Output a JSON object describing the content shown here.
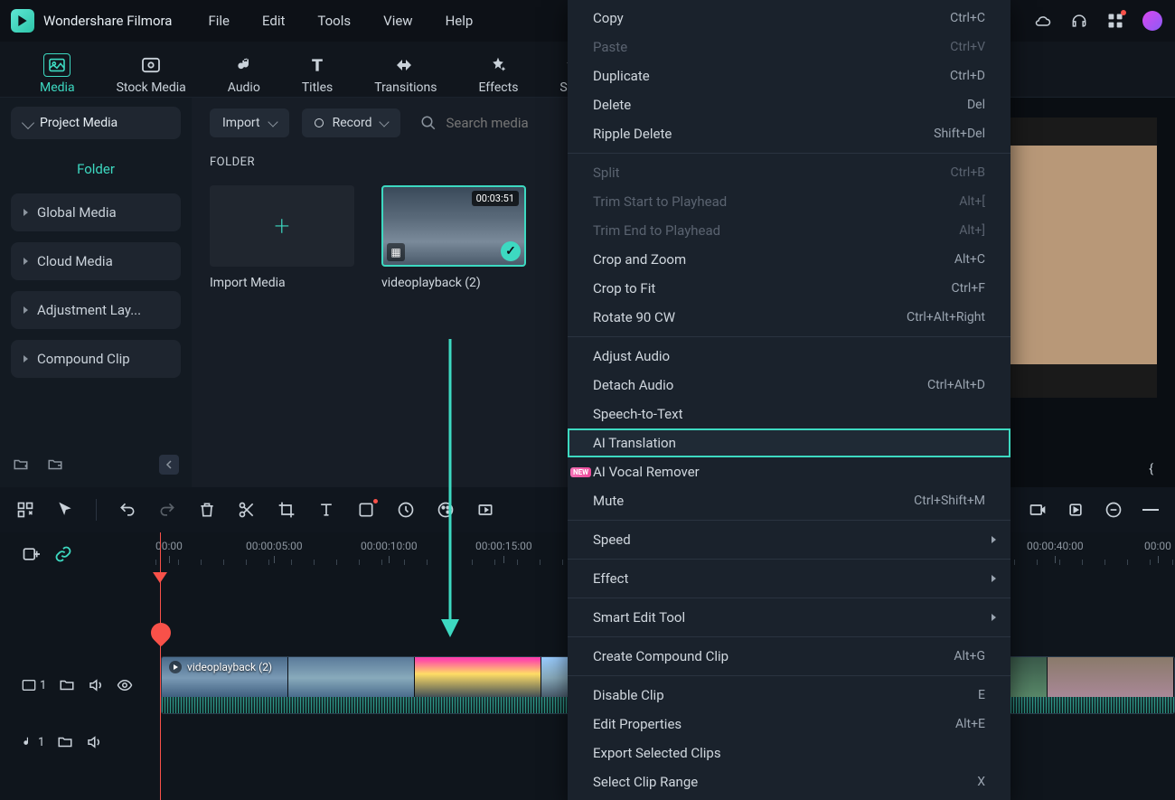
{
  "app_name": "Wondershare Filmora",
  "menu": [
    "File",
    "Edit",
    "Tools",
    "View",
    "Help"
  ],
  "tabs": [
    {
      "label": "Media",
      "active": true
    },
    {
      "label": "Stock Media"
    },
    {
      "label": "Audio"
    },
    {
      "label": "Titles"
    },
    {
      "label": "Transitions"
    },
    {
      "label": "Effects"
    },
    {
      "label": "Stick"
    }
  ],
  "sidebar": {
    "project_media": "Project Media",
    "folder": "Folder",
    "items": [
      "Global Media",
      "Cloud Media",
      "Adjustment Lay...",
      "Compound Clip"
    ]
  },
  "browser": {
    "import": "Import",
    "record": "Record",
    "search_placeholder": "Search media",
    "folder_header": "FOLDER",
    "import_media": "Import Media",
    "clip_name": "videoplayback (2)",
    "clip_duration": "00:03:51"
  },
  "ruler": [
    "00:00",
    "00:00:05:00",
    "00:00:10:00",
    "00:00:15:00",
    "00:00:40:00",
    "00:00"
  ],
  "timeline": {
    "video_track": "1",
    "audio_track": "1",
    "clip_label": "videoplayback (2)"
  },
  "preview": {
    "brace": "{"
  },
  "context": [
    {
      "label": "Copy",
      "short": "Ctrl+C"
    },
    {
      "label": "Paste",
      "short": "Ctrl+V",
      "disabled": true
    },
    {
      "label": "Duplicate",
      "short": "Ctrl+D"
    },
    {
      "label": "Delete",
      "short": "Del"
    },
    {
      "label": "Ripple Delete",
      "short": "Shift+Del"
    },
    {
      "separator": true
    },
    {
      "label": "Split",
      "short": "Ctrl+B",
      "disabled": true
    },
    {
      "label": "Trim Start to Playhead",
      "short": "Alt+[",
      "disabled": true
    },
    {
      "label": "Trim End to Playhead",
      "short": "Alt+]",
      "disabled": true
    },
    {
      "label": "Crop and Zoom",
      "short": "Alt+C"
    },
    {
      "label": "Crop to Fit",
      "short": "Ctrl+F"
    },
    {
      "label": "Rotate 90 CW",
      "short": "Ctrl+Alt+Right"
    },
    {
      "separator": true
    },
    {
      "label": "Adjust Audio"
    },
    {
      "label": "Detach Audio",
      "short": "Ctrl+Alt+D"
    },
    {
      "label": "Speech-to-Text"
    },
    {
      "label": "AI Translation",
      "highlight": true
    },
    {
      "label": "AI Vocal Remover",
      "badge": "NEW"
    },
    {
      "label": "Mute",
      "short": "Ctrl+Shift+M"
    },
    {
      "separator": true
    },
    {
      "label": "Speed",
      "submenu": true
    },
    {
      "separator": true
    },
    {
      "label": "Effect",
      "submenu": true
    },
    {
      "separator": true
    },
    {
      "label": "Smart Edit Tool",
      "submenu": true
    },
    {
      "separator": true
    },
    {
      "label": "Create Compound Clip",
      "short": "Alt+G"
    },
    {
      "separator": true
    },
    {
      "label": "Disable Clip",
      "short": "E"
    },
    {
      "label": "Edit Properties",
      "short": "Alt+E"
    },
    {
      "label": "Export Selected Clips"
    },
    {
      "label": "Select Clip Range",
      "short": "X"
    }
  ]
}
